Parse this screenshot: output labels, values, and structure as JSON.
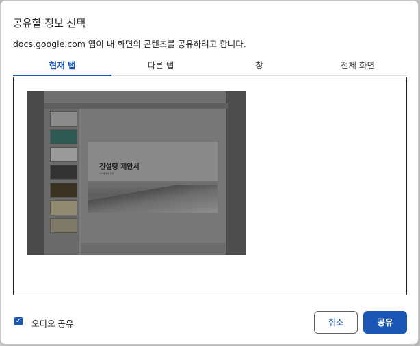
{
  "dialog": {
    "title": "공유할 정보 선택",
    "subtitle": "docs.google.com 앱이 내 화면의 콘텐츠를 공유하려고 합니다."
  },
  "tabs": [
    {
      "label": "현재 탭",
      "active": true
    },
    {
      "label": "다른 탭",
      "active": false
    },
    {
      "label": "창",
      "active": false
    },
    {
      "label": "전체 화면",
      "active": false
    }
  ],
  "preview": {
    "slide_title": "컨설팅 제안서",
    "slide_subtitle": "여기에 부제 입력"
  },
  "footer": {
    "audio_label": "오디오 공유",
    "audio_checked": true,
    "cancel_label": "취소",
    "share_label": "공유"
  },
  "colors": {
    "accent": "#1a56b4"
  }
}
